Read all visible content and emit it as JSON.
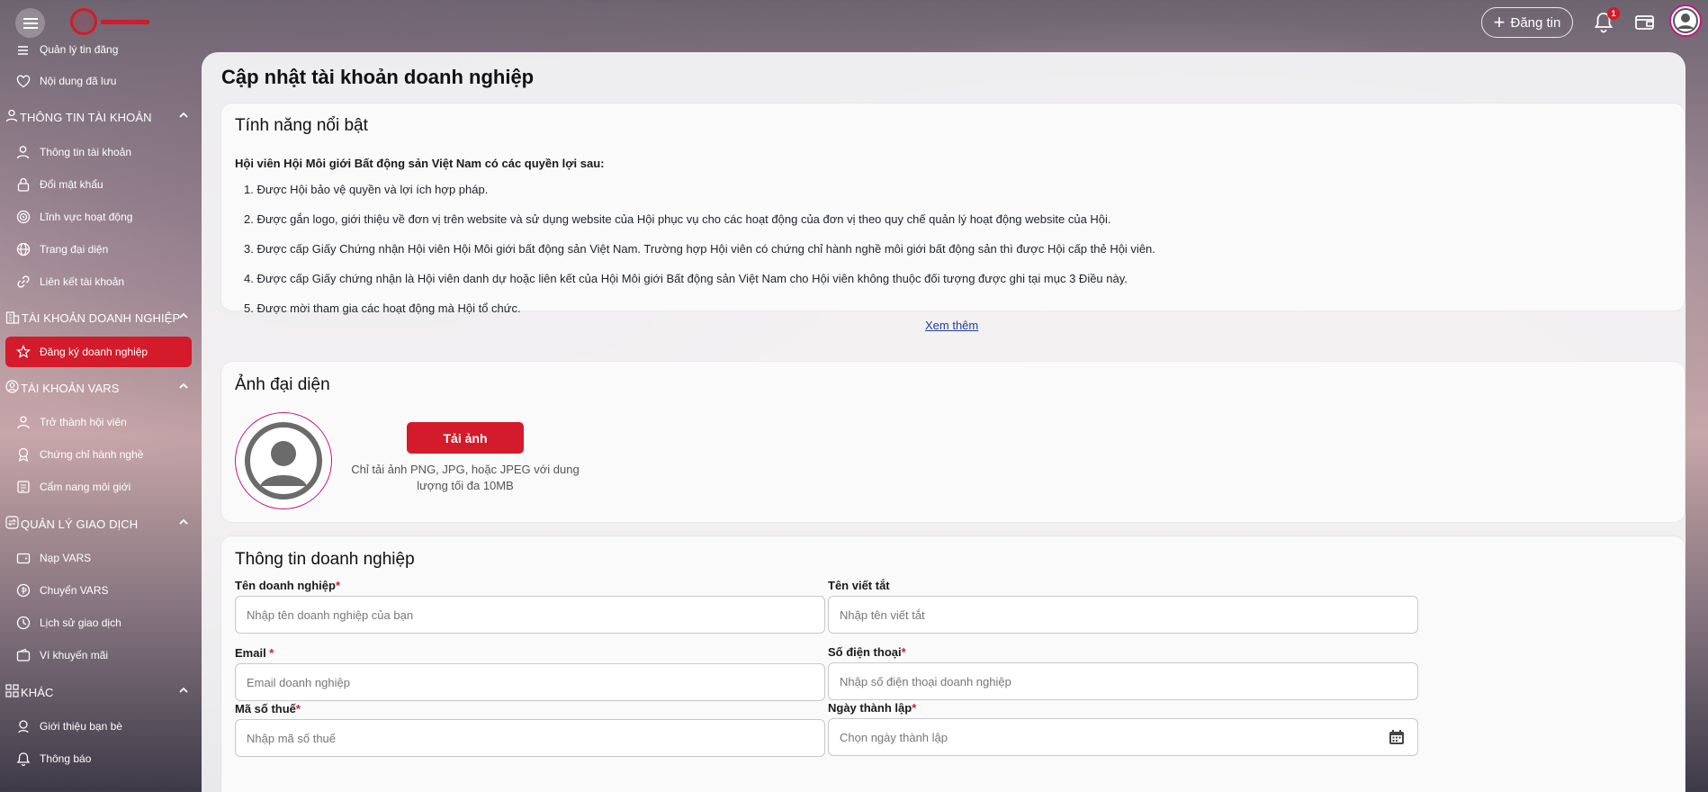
{
  "header": {
    "post_label": "Đăng tin",
    "notification_count": "1"
  },
  "sidebar": {
    "top_cut_item": "Quản lý tin đăng",
    "saved_item": "Nội dung đã lưu",
    "sections": [
      {
        "label": "THÔNG TIN TÀI KHOẢN",
        "items": [
          "Thông tin tài khoản",
          "Đổi mật khẩu",
          "Lĩnh vực hoạt động",
          "Trang đại diện",
          "Liên kết tài khoản"
        ]
      },
      {
        "label": "TÀI KHOẢN DOANH NGHIỆP",
        "items": [
          "Đăng ký doanh nghiệp"
        ]
      },
      {
        "label": "TÀI KHOẢN VARS",
        "items": [
          "Trở thành hội viên",
          "Chứng chỉ hành nghề",
          "Cẩm nang môi giới"
        ]
      },
      {
        "label": "QUẢN LÝ GIAO DỊCH",
        "items": [
          "Nạp VARS",
          "Chuyển VARS",
          "Lịch sử giao dịch",
          "Ví khuyến mãi"
        ]
      },
      {
        "label": "KHÁC",
        "items": [
          "Giới thiệu bạn bè",
          "Thông báo"
        ]
      }
    ]
  },
  "page": {
    "title": "Cập nhật tài khoản doanh nghiệp"
  },
  "features": {
    "title": "Tính năng nổi bật",
    "intro": "Hội viên Hội Môi giới Bất động sản Việt Nam có các quyền lợi sau:",
    "items": [
      "1. Được Hội bảo vệ quyền và lợi ích hợp pháp.",
      "2. Được gắn logo, giới thiệu về đơn vị trên website và sử dụng website của Hội phục vụ cho các hoạt động của đơn vị theo quy chế quản lý hoạt động website của Hội.",
      "3. Được cấp Giấy Chứng nhận Hội viên Hội Môi giới bất động sản Việt Nam. Trường hợp Hội viên có chứng chỉ hành nghề môi giới bất động sản thì được Hội cấp thẻ Hội viên.",
      "4. Được cấp Giấy chứng nhận là Hội viên danh dự hoặc liên kết của Hội Môi giới Bất động sản Việt Nam cho Hội viên không thuộc đối tượng được ghi tại mục 3 Điều này.",
      "5. Được mời tham gia các hoạt động mà Hội tổ chức."
    ],
    "see_more": "Xem thêm"
  },
  "avatar_card": {
    "title": "Ảnh đại diện",
    "upload_label": "Tải ảnh",
    "hint": "Chỉ tải ảnh PNG, JPG, hoặc JPEG với dung lượng tối đa 10MB"
  },
  "business_form": {
    "title": "Thông tin doanh nghiệp",
    "company_name": {
      "label": "Tên doanh nghiệp",
      "placeholder": "Nhập tên doanh nghiệp của bạn"
    },
    "short_name": {
      "label": "Tên viết tắt",
      "placeholder": "Nhập tên viết tắt"
    },
    "email": {
      "label": "Email ",
      "placeholder": "Email doanh nghiệp"
    },
    "phone": {
      "label": "Số điện thoại",
      "placeholder": "Nhập số điện thoại doanh nghiệp"
    },
    "tax_code": {
      "label": "Mã số thuế",
      "placeholder": "Nhập mã số thuế"
    },
    "founded_date": {
      "label": "Ngày thành lập",
      "placeholder": "Chọn ngày thành lập"
    },
    "required_mark": "*"
  },
  "colors": {
    "accent": "#d31b2b",
    "avatar_ring": "#c71585",
    "link": "#1f3f9c"
  }
}
